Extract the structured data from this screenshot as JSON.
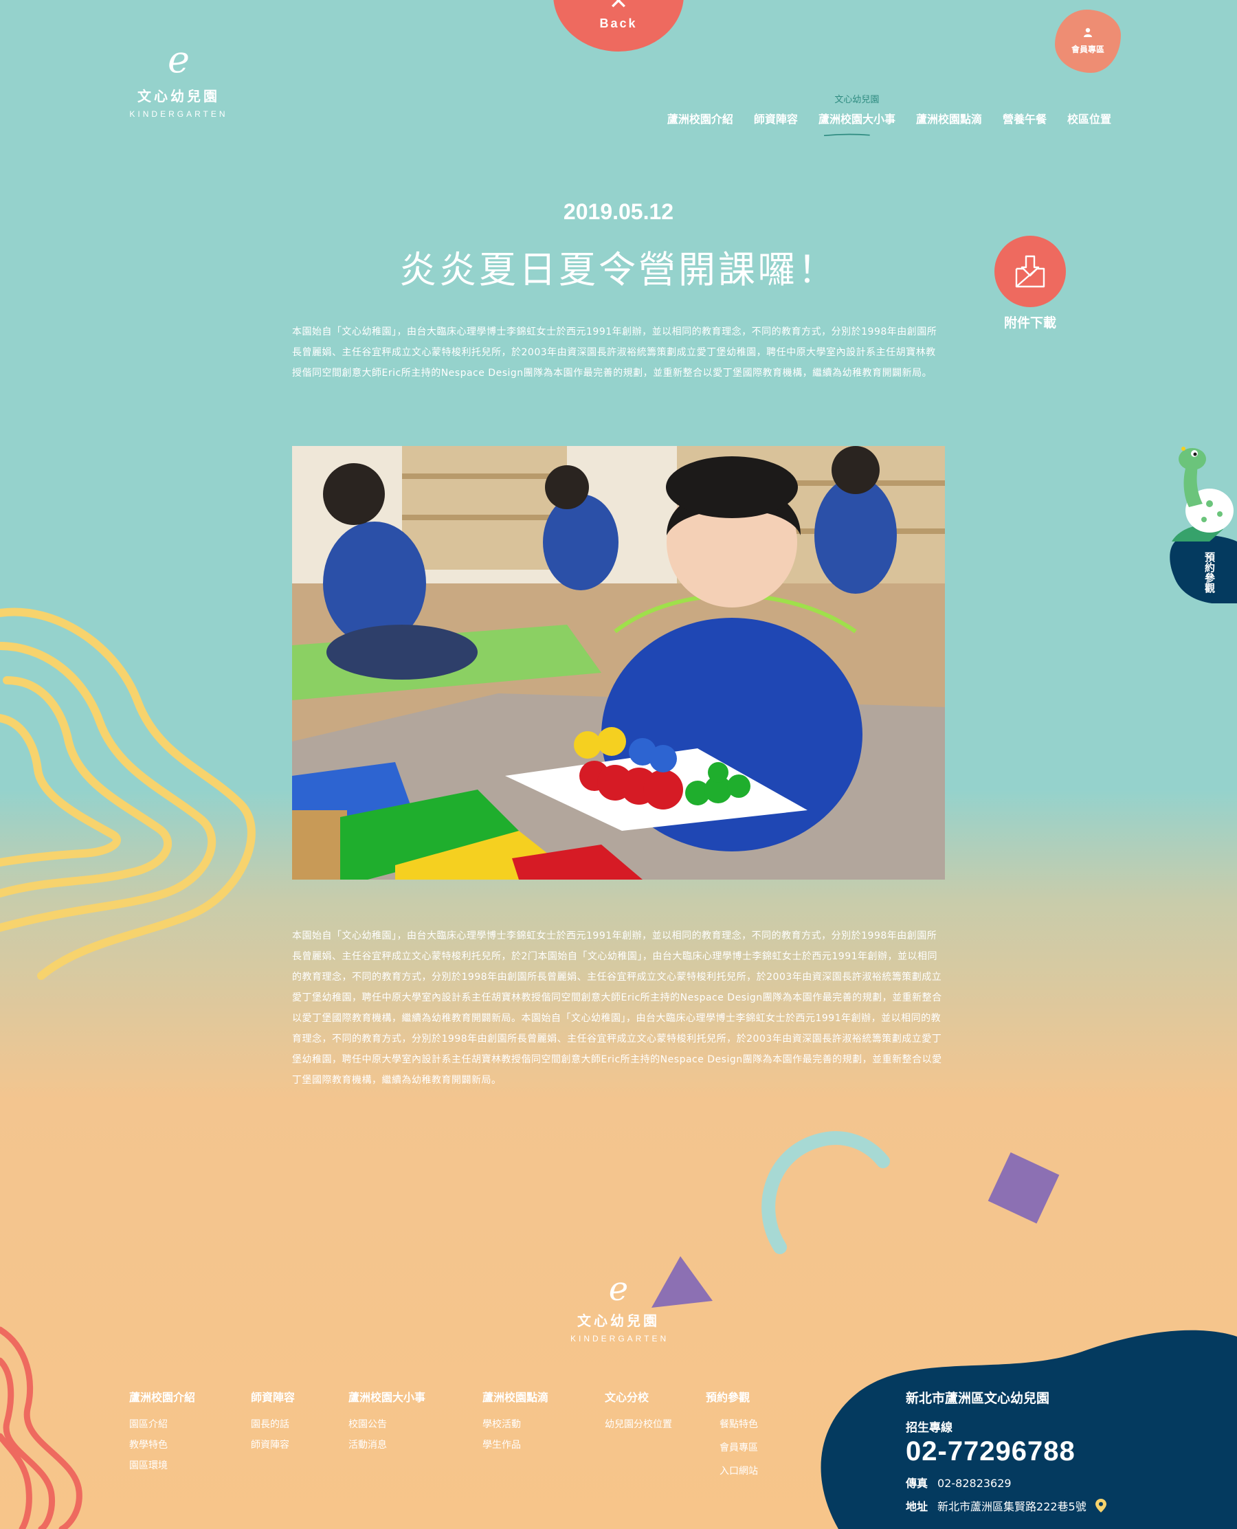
{
  "brand": {
    "name": "文心幼兒園",
    "sub": "KINDERGARTEN",
    "mark": "e"
  },
  "back": {
    "label": "Back",
    "icon": "close-icon"
  },
  "member": {
    "label": "會員專區",
    "icon": "user-icon"
  },
  "nav": {
    "active_super": "文心幼兒園",
    "items": [
      {
        "label": "蘆洲校園介紹"
      },
      {
        "label": "師資陣容"
      },
      {
        "label": "蘆洲校園大小事"
      },
      {
        "label": "蘆洲校園點滴"
      },
      {
        "label": "營養午餐"
      },
      {
        "label": "校區位置"
      }
    ]
  },
  "article": {
    "date": "2019.05.12",
    "title": "炎炎夏日夏令營開課囉！",
    "download_label": "附件下載",
    "paragraph1": "本園始自「文心幼稚園」，由台大臨床心理學博士李錦虹女士於西元1991年創辦，並以相同的教育理念，不同的教育方式，分別於1998年由創園所長曾麗娟、主任谷宜秤成立文心蒙特梭利托兒所，於2003年由資深園長許淑裕統籌策劃成立愛丁堡幼稚園，聘任中原大學室內設計系主任胡寶林教授偕同空間創意大師Eric所主持的Nespace Design團隊為本園作最完善的規劃，並重新整合以愛丁堡國際教育機構，繼續為幼稚教育開闢新局。",
    "paragraph2": "本園始自「文心幼稚園」，由台大臨床心理學博士李錦虹女士於西元1991年創辦，並以相同的教育理念，不同的教育方式，分別於1998年由創園所長曾麗娟、主任谷宜秤成立文心蒙特梭利托兒所，於2门本園始自「文心幼稚園」，由台大臨床心理學博士李錦虹女士於西元1991年創辦，並以相同的教育理念，不同的教育方式，分別於1998年由創園所長曾麗娟、主任谷宜秤成立文心蒙特梭利托兒所，於2003年由資深園長許淑裕統籌策劃成立愛丁堡幼稚園，聘任中原大學室內設計系主任胡寶林教授偕同空間創意大師Eric所主持的Nespace Design團隊為本園作最完善的規劃，並重新整合以愛丁堡國際教育機構，繼續為幼稚教育開闢新局。本園始自「文心幼稚園」，由台大臨床心理學博士李錦虹女士於西元1991年創辦，並以相同的教育理念，不同的教育方式，分別於1998年由創園所長曾麗娟、主任谷宜秤成立文心蒙特梭利托兒所，於2003年由資深園長許淑裕統籌策劃成立愛丁堡幼稚園，聘任中原大學室內設計系主任胡寶林教授偕同空間創意大師Eric所主持的Nespace Design團隊為本園作最完善的規劃，並重新整合以愛丁堡國際教育機構，繼續為幼稚教育開闢新局。"
  },
  "visit_tab": {
    "label": "預約參觀"
  },
  "footer": {
    "columns": [
      {
        "head": "蘆洲校園介紹",
        "links": [
          "園區介紹",
          "教學特色",
          "園區環境"
        ]
      },
      {
        "head": "師資陣容",
        "links": [
          "園長的話",
          "師資陣容"
        ]
      },
      {
        "head": "蘆洲校園大小事",
        "links": [
          "校園公告",
          "活動消息"
        ]
      },
      {
        "head": "蘆洲校園點滴",
        "links": [
          "學校活動",
          "學生作品"
        ]
      },
      {
        "head": "文心分校",
        "links": [
          "幼兒園分校位置"
        ]
      },
      {
        "head": "預約參觀",
        "links": [
          "餐點特色",
          "會員專區",
          "入口網站"
        ]
      }
    ],
    "contact": {
      "title": "新北市蘆洲區文心幼兒園",
      "line_label": "招生專線",
      "phone": "02-77296788",
      "fax_label": "傳真",
      "fax": "02-82823629",
      "address_label": "地址",
      "address": "新北市蘆洲區集賢路222巷5號",
      "address_icon": "map-pin-icon"
    }
  },
  "colors": {
    "teal_bg": "#95d2cc",
    "peach_bg": "#f7c58a",
    "coral": "#ee6a5f",
    "navy": "#043a5f",
    "yellow_line": "#f7d36d",
    "purple": "#8c70b3",
    "light_teal": "#a7d9d4"
  }
}
